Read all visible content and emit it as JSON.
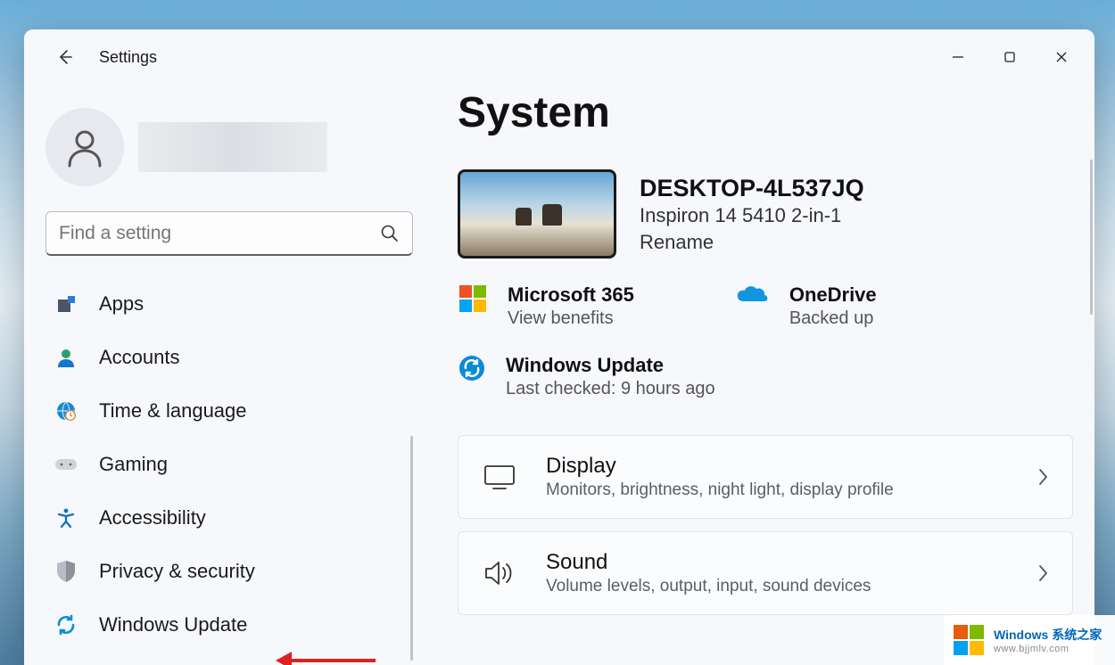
{
  "window": {
    "title": "Settings"
  },
  "search": {
    "placeholder": "Find a setting"
  },
  "sidebar": {
    "items": [
      {
        "label": "Apps"
      },
      {
        "label": "Accounts"
      },
      {
        "label": "Time & language"
      },
      {
        "label": "Gaming"
      },
      {
        "label": "Accessibility"
      },
      {
        "label": "Privacy & security"
      },
      {
        "label": "Windows Update"
      }
    ]
  },
  "page": {
    "title": "System"
  },
  "device": {
    "name": "DESKTOP-4L537JQ",
    "model": "Inspiron 14 5410 2-in-1",
    "rename": "Rename"
  },
  "status": {
    "m365": {
      "title": "Microsoft 365",
      "sub": "View benefits"
    },
    "onedrive": {
      "title": "OneDrive",
      "sub": "Backed up"
    },
    "wu": {
      "title": "Windows Update",
      "sub": "Last checked: 9 hours ago"
    }
  },
  "cards": [
    {
      "title": "Display",
      "sub": "Monitors, brightness, night light, display profile"
    },
    {
      "title": "Sound",
      "sub": "Volume levels, output, input, sound devices"
    }
  ],
  "watermark": {
    "line1a": "Windows",
    "line1b": "系统之家",
    "line2": "www.bjjmlv.com"
  }
}
